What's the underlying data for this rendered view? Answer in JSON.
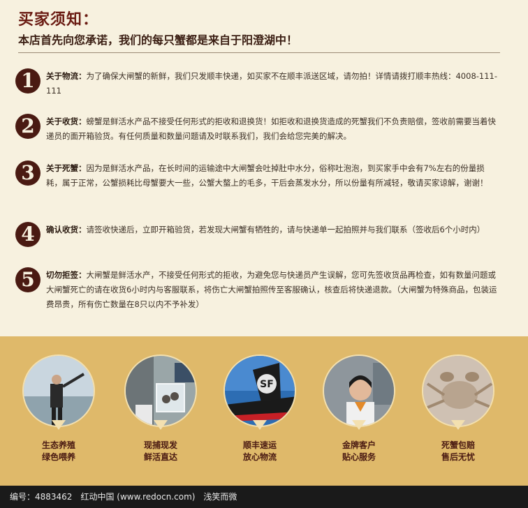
{
  "header": {
    "title": "买家须知：",
    "subtitle": "本店首先向您承诺，我们的每只蟹都是来自于阳澄湖中！"
  },
  "items": [
    {
      "num": "1",
      "label": "关于物流：",
      "text": "为了确保大闸蟹的新鲜，我们只发顺丰快递，如买家不在顺丰派送区域，请勿拍！详情请拨打顺丰热线：4008-111-111"
    },
    {
      "num": "2",
      "label": "关于收货：",
      "text": "螃蟹是鲜活水产品不接受任何形式的拒收和退换货！如拒收和退换货造成的死蟹我们不负责赔偿，签收前需要当着快递员的面开箱验货。有任何质量和数量问题请及时联系我们，我们会给您完美的解决。"
    },
    {
      "num": "3",
      "label": "关于死蟹：",
      "text": "因为是鲜活水产品，在长时间的运输途中大闸蟹会吐掉肚中水分，俗称吐泡泡，到买家手中会有7%左右的份量损耗，属于正常，公蟹损耗比母蟹要大一些，公蟹大螯上的毛多，干后会蒸发水分，所以份量有所减轻，敬请买家谅解，谢谢！"
    },
    {
      "num": "4",
      "label": "确认收货：",
      "text": "请签收快递后，立即开箱验货，若发现大闸蟹有牺牲的，请与快递单一起拍照并与我们联系（签收后6个小时内）"
    },
    {
      "num": "5",
      "label": "切勿拒签：",
      "text": "大闸蟹是鲜活水产，不接受任何形式的拒收，为避免您与快递员产生误解，您可先签收货品再检查，如有数量问题或大闸蟹死亡的请在收货6小时内与客服联系，将伤亡大闸蟹拍照传至客服确认，核查后将快递退款。（大闸蟹为特殊商品，包装运费昂贵，所有伤亡数量在8只以内不予补发）"
    }
  ],
  "features": [
    {
      "line1": "生态养殖",
      "line2": "绿色喂养"
    },
    {
      "line1": "现捕现发",
      "line2": "鲜活直达"
    },
    {
      "line1": "顺丰速运",
      "line2": "放心物流"
    },
    {
      "line1": "金牌客户",
      "line2": "贴心服务"
    },
    {
      "line1": "死蟹包赔",
      "line2": "售后无忧"
    }
  ],
  "footer": {
    "text": "编号：4883462　红动中国 (www.redocn.com)　浅笑而微"
  }
}
